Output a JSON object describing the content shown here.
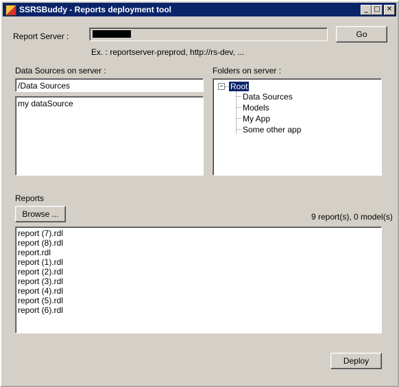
{
  "window": {
    "title": "SSRSBuddy - Reports deployment tool",
    "controls": {
      "minimize": "_",
      "maximize": "□",
      "close": "✕"
    }
  },
  "server": {
    "label": "Report Server :",
    "value_redacted": true,
    "hint": "Ex. : reportserver-preprod, http://rs-dev, ...",
    "go_label": "Go"
  },
  "datasources": {
    "label": "Data Sources on server :",
    "path": "/Data Sources",
    "items": [
      "my dataSource"
    ]
  },
  "folders": {
    "label": "Folders on server :",
    "root": {
      "expander": "−",
      "label": "Root",
      "selected": true
    },
    "children": [
      "Data Sources",
      "Models",
      "My App",
      "Some other app"
    ]
  },
  "reports": {
    "label": "Reports",
    "browse_label": "Browse ...",
    "count_text": "9 report(s), 0 model(s)",
    "items": [
      "report (7).rdl",
      "report (8).rdl",
      "report.rdl",
      "report (1).rdl",
      "report (2).rdl",
      "report (3).rdl",
      "report (4).rdl",
      "report (5).rdl",
      "report (6).rdl"
    ]
  },
  "footer": {
    "deploy_label": "Deploy"
  }
}
